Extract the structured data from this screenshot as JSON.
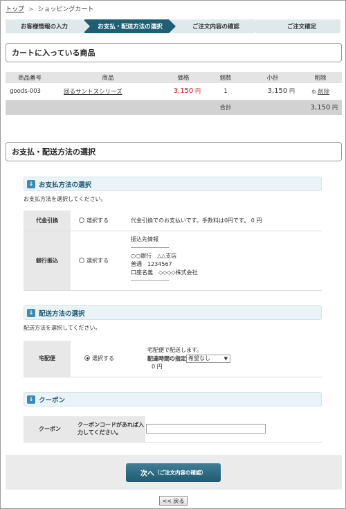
{
  "breadcrumb": {
    "top": "トップ",
    "separator": ">",
    "current": "ショッピングカート"
  },
  "steps": [
    "お客様情報の入力",
    "お支払・配送方法の選択",
    "ご注文内容の確認",
    "ご注文確定"
  ],
  "active_step": 1,
  "cart": {
    "title": "カートに入っている商品",
    "headers": {
      "code": "商品番号",
      "product": "商品",
      "price": "価格",
      "qty": "個数",
      "subtotal": "小計",
      "delete": "削除"
    },
    "row": {
      "code": "goods-003",
      "product": "回るサントスシリーズ",
      "price": "3,150",
      "qty": "1",
      "subtotal": "3,150",
      "delete": "削除"
    },
    "yen": "円",
    "total_label": "合計",
    "total_value": "3,150"
  },
  "payment_section": {
    "title": "お支払・配送方法の選択",
    "payment": {
      "title": "お支払方法の選択",
      "desc": "お支払方法を選択してください。",
      "cod": {
        "label": "代金引換",
        "radio": "選択する",
        "note": "代金引換でのお支払いです。手数料は0円です。 0 円"
      },
      "bank": {
        "label": "銀行振込",
        "radio": "選択する",
        "lines": [
          "振込先情報",
          "---------------------------------",
          "○○銀行　△△支店",
          "普通　1234567",
          "口座名義　◇◇◇◇株式会社",
          "---------------------------------"
        ]
      }
    },
    "delivery": {
      "title": "配送方法の選択",
      "desc": "配送方法を選択してください。",
      "label": "宅配便",
      "radio": "選択する",
      "note": "宅配便で配送します。",
      "time_label": "配達時間の指定",
      "time_value": "希望なし",
      "fee": "0 円"
    },
    "coupon": {
      "title": "クーポン",
      "label": "クーポン",
      "prompt_line1": "クーポンコードがあれば入",
      "prompt_line2": "力してください。",
      "input_value": ""
    }
  },
  "buttons": {
    "next_main": "次へ",
    "next_sub": "（ご注文内容の確認）",
    "back": "<< 戻る"
  }
}
